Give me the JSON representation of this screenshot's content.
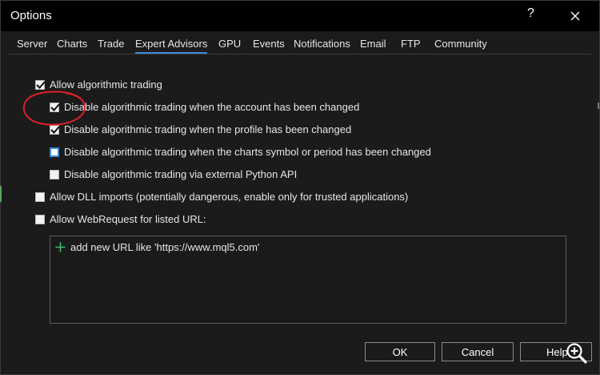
{
  "window": {
    "title": "Options",
    "help_glyph": "?"
  },
  "tabs": [
    {
      "label": "Server"
    },
    {
      "label": "Charts"
    },
    {
      "label": "Trade"
    },
    {
      "label": "Expert Advisors",
      "active": true
    },
    {
      "label": "GPU"
    },
    {
      "label": "Events"
    },
    {
      "label": "Notifications"
    },
    {
      "label": "Email"
    },
    {
      "label": "FTP"
    },
    {
      "label": "Community"
    }
  ],
  "options": {
    "allow_algo": {
      "label": "Allow algorithmic trading",
      "checked": true
    },
    "disable_account": {
      "label": "Disable algorithmic trading when the account has been changed",
      "checked": true
    },
    "disable_profile": {
      "label": "Disable algorithmic trading when the profile has been changed",
      "checked": true
    },
    "disable_symbol": {
      "label": "Disable algorithmic trading when the charts symbol or period has been changed",
      "checked": false,
      "focused": true
    },
    "disable_python": {
      "label": "Disable algorithmic trading via external Python API",
      "checked": false
    },
    "allow_dll": {
      "label": "Allow DLL imports (potentially dangerous, enable only for trusted applications)",
      "checked": false
    },
    "allow_webrequest": {
      "label": "Allow WebRequest for listed URL:",
      "checked": false
    }
  },
  "url_list": {
    "add_text": "add new URL like 'https://www.mql5.com'"
  },
  "buttons": {
    "ok": "OK",
    "cancel": "Cancel",
    "help": "Help"
  },
  "colors": {
    "accent": "#3d8cd6",
    "annotation": "#e0202a",
    "add_icon": "#3cbf6a",
    "background": "#1f1f1f"
  },
  "icons": [
    "close-icon",
    "checkmark-icon",
    "plus-icon",
    "zoom-in-icon"
  ]
}
